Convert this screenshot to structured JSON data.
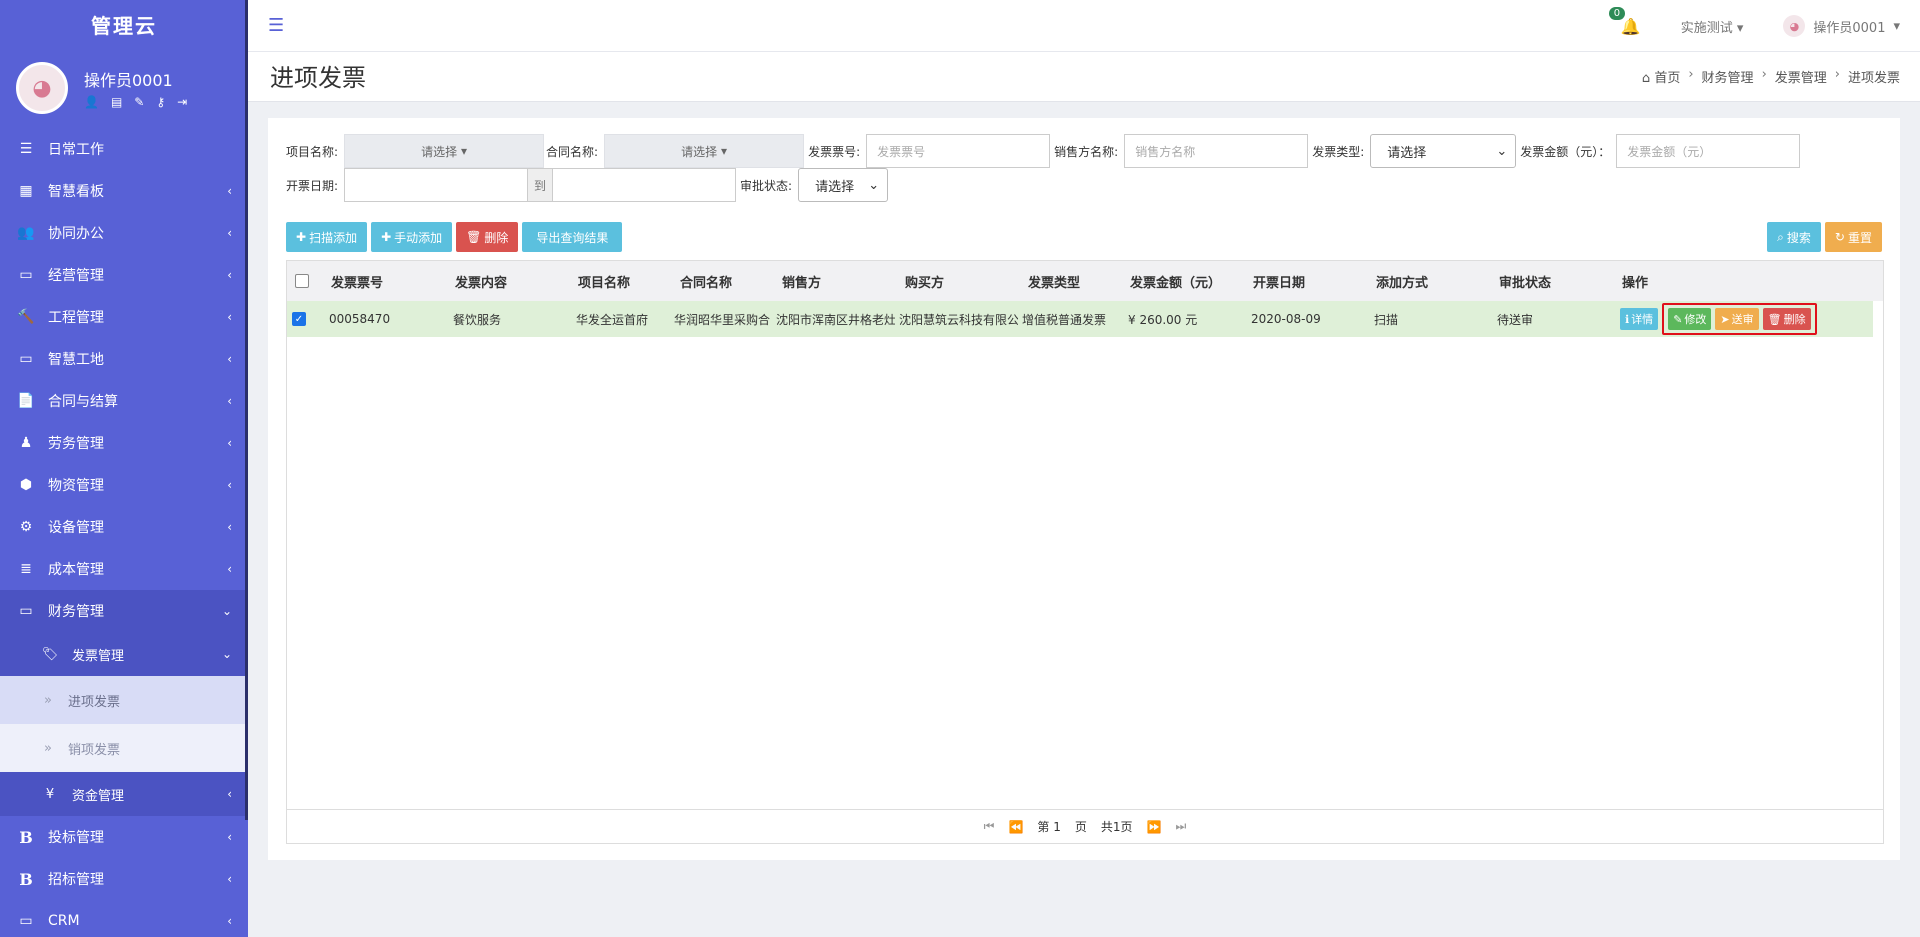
{
  "sidebar": {
    "brand": "管理云",
    "user_name": "操作员0001",
    "menu": [
      {
        "label": "日常工作",
        "icon": "☰",
        "arrow": ""
      },
      {
        "label": "智慧看板",
        "icon": "▦",
        "arrow": "‹"
      },
      {
        "label": "协同办公",
        "icon": "👥",
        "arrow": "‹"
      },
      {
        "label": "经营管理",
        "icon": "▭",
        "arrow": "‹"
      },
      {
        "label": "工程管理",
        "icon": "🔨",
        "arrow": "‹"
      },
      {
        "label": "智慧工地",
        "icon": "▭",
        "arrow": "‹"
      },
      {
        "label": "合同与结算",
        "icon": "📄",
        "arrow": "‹"
      },
      {
        "label": "劳务管理",
        "icon": "♟",
        "arrow": "‹"
      },
      {
        "label": "物资管理",
        "icon": "⬢",
        "arrow": "‹"
      },
      {
        "label": "设备管理",
        "icon": "⚙",
        "arrow": "‹"
      },
      {
        "label": "成本管理",
        "icon": "≣",
        "arrow": "‹"
      },
      {
        "label": "财务管理",
        "icon": "▭",
        "arrow": "⌄"
      }
    ],
    "sub_invoice": {
      "label": "发票管理",
      "icon": "🏷",
      "arrow": "⌄"
    },
    "leaf_in": "进项发票",
    "leaf_out": "销项发票",
    "leaf_chev": "»",
    "sub_fund": {
      "label": "资金管理",
      "icon": "¥",
      "arrow": "‹"
    },
    "menu_after": [
      {
        "label": "投标管理",
        "icon": "B",
        "arrow": "‹"
      },
      {
        "label": "招标管理",
        "icon": "B",
        "arrow": "‹"
      },
      {
        "label": "CRM",
        "icon": "▭",
        "arrow": "‹"
      }
    ]
  },
  "topbar": {
    "bell_count": "0",
    "env": "实施测试",
    "user": "操作员0001"
  },
  "page": {
    "title": "进项发票",
    "breadcrumb": [
      "首页",
      "财务管理",
      "发票管理",
      "进项发票"
    ]
  },
  "filters": {
    "project_label": "项目名称:",
    "project_value": "请选择",
    "contract_label": "合同名称:",
    "contract_value": "请选择",
    "invoice_no_label": "发票票号:",
    "invoice_no_placeholder": "发票票号",
    "seller_label": "销售方名称:",
    "seller_placeholder": "销售方名称",
    "type_label": "发票类型:",
    "type_value": "请选择",
    "amount_label": "发票金额（元）：",
    "amount_placeholder": "发票金额（元）",
    "date_label": "开票日期:",
    "date_to": "到",
    "approval_label": "审批状态:",
    "approval_value": "请选择"
  },
  "toolbar": {
    "scan_add": "扫描添加",
    "manual_add": "手动添加",
    "delete": "删除",
    "export": "导出查询结果",
    "search": "搜索",
    "reset": "重置"
  },
  "table": {
    "headers": [
      "发票票号",
      "发票内容",
      "项目名称",
      "合同名称",
      "销售方",
      "购买方",
      "发票类型",
      "发票金额（元）",
      "开票日期",
      "添加方式",
      "审批状态",
      "操作"
    ],
    "rows": [
      {
        "invoice_no": "00058470",
        "content": "餐饮服务",
        "project": "华发全运首府",
        "contract": "华润昭华里采购合",
        "seller": "沈阳市浑南区井格老灶",
        "buyer": "沈阳慧筑云科技有限公",
        "type": "增值税普通发票",
        "amount": "¥ 260.00 元",
        "date": "2020-08-09",
        "method": "扫描",
        "status": "待送审",
        "actions": {
          "detail": "详情",
          "edit": "修改",
          "submit": "送审",
          "delete": "删除"
        }
      }
    ]
  },
  "pager": {
    "page_prefix": "第",
    "page_value": "1",
    "page_suffix": "页",
    "total": "共1页"
  }
}
